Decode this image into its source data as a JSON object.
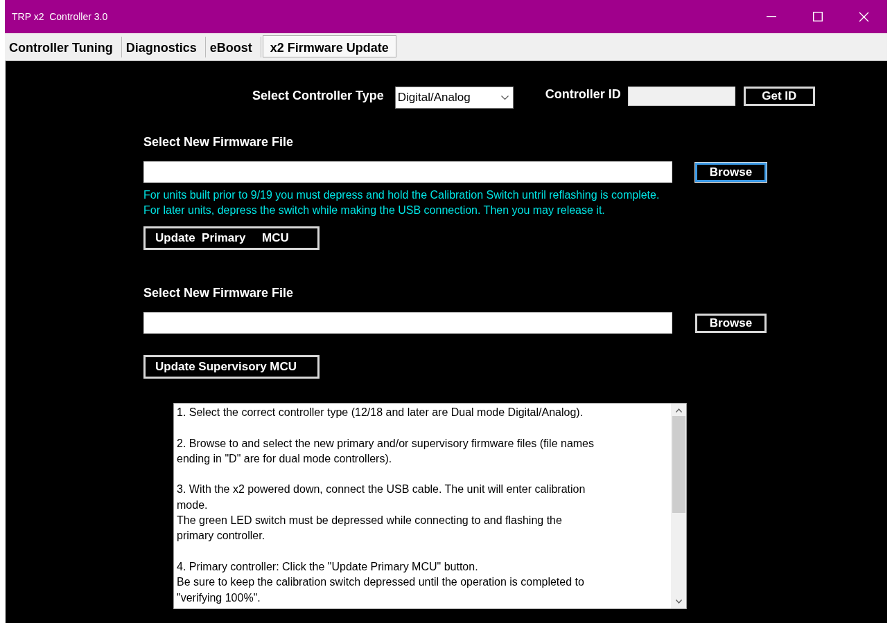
{
  "window": {
    "title": "TRP x2  Controller 3.0"
  },
  "tabs": [
    {
      "label": "Controller Tuning",
      "selected": false
    },
    {
      "label": "Diagnostics",
      "selected": false
    },
    {
      "label": "eBoost",
      "selected": false
    },
    {
      "label": "x2 Firmware Update",
      "selected": true
    }
  ],
  "controller": {
    "type_label": "Select Controller Type",
    "type_value": "Digital/Analog",
    "id_label": "Controller ID",
    "id_button": "Get ID"
  },
  "firmware_sections": [
    {
      "label": "Select New Firmware File",
      "browse": "Browse",
      "browse_focused": true,
      "notes": [
        "For units built prior to 9/19 you must depress and hold the Calibration Switch untril reflashing is complete.",
        "For later units, depress the switch while making the USB connection. Then you may release it."
      ],
      "update_button": "Update  Primary     MCU"
    },
    {
      "label": "Select New Firmware File",
      "browse": "Browse",
      "browse_focused": false,
      "update_button": "Update Supervisory MCU"
    }
  ],
  "instructions": [
    [
      "1. Select the correct controller type (12/18 and later are Dual mode Digital/Analog)."
    ],
    [
      "2. Browse to and select the new primary and/or supervisory firmware files (file names",
      "ending in \"D\" are for dual mode controllers)."
    ],
    [
      "3. With the x2 powered down, connect the USB cable. The unit will enter calibration",
      "mode.",
      "The green LED switch must be depressed while connecting to and flashing the",
      "primary controller."
    ],
    [
      "4. Primary controller:  Click the \"Update Primary MCU\" button.",
      "Be sure to keep the calibration switch depressed until the operation is completed to",
      "\"verifying 100%\"."
    ]
  ]
}
